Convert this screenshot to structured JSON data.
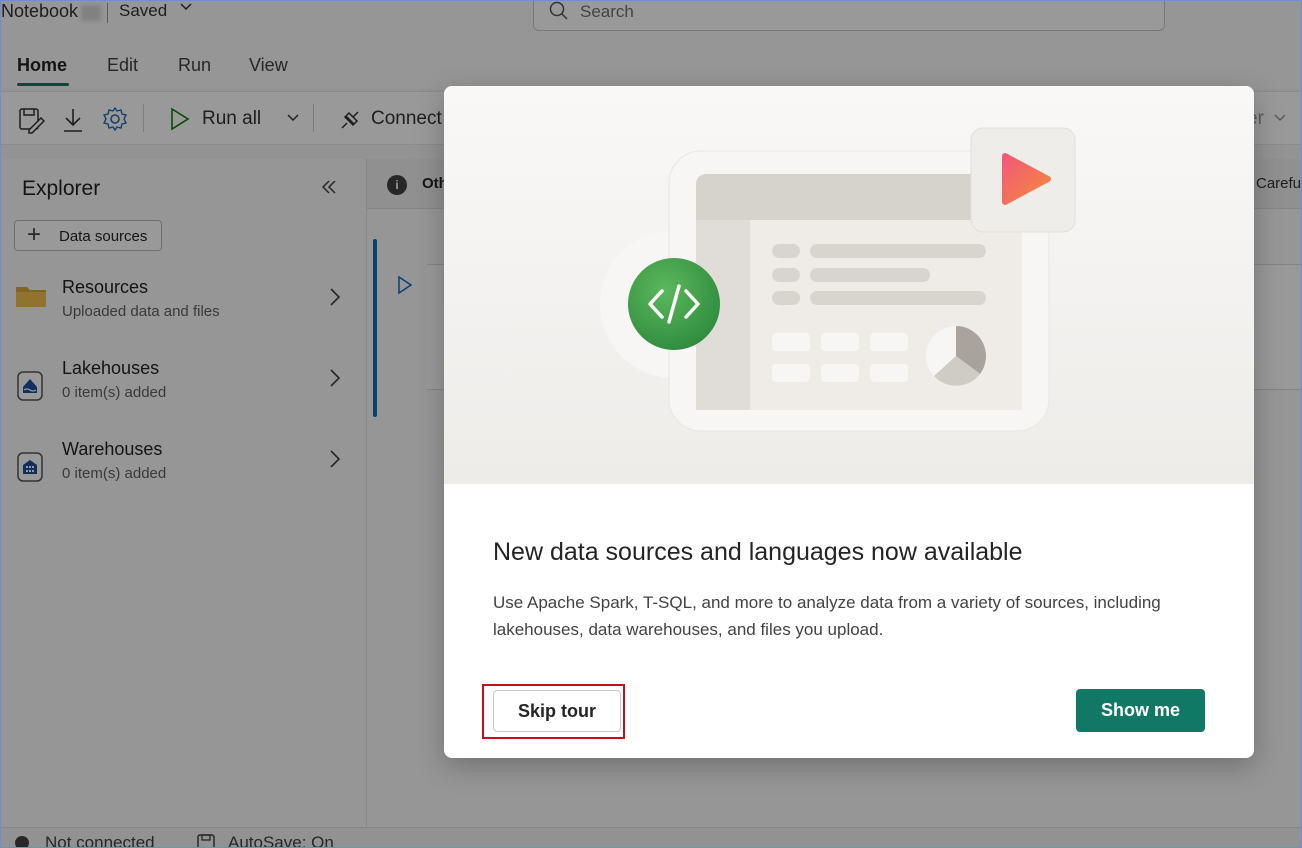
{
  "titlebar": {
    "notebook_name": "Notebook",
    "status": "Saved",
    "search_placeholder": "Search"
  },
  "menu_tabs": [
    "Home",
    "Edit",
    "Run",
    "View"
  ],
  "toolbar": {
    "run_all": "Run all",
    "connect": "Connect",
    "partial_right": "er"
  },
  "explorer": {
    "title": "Explorer",
    "add_button": "Data sources",
    "items": [
      {
        "name": "Resources",
        "sub": "Uploaded data and files"
      },
      {
        "name": "Lakehouses",
        "sub": "0 item(s) added"
      },
      {
        "name": "Warehouses",
        "sub": "0 item(s) added"
      }
    ]
  },
  "editor": {
    "info_text": "Oth",
    "info_right": "Carefu"
  },
  "statusbar": {
    "connection": "Not connected",
    "autosave": "AutoSave: On"
  },
  "dialog": {
    "title": "New data sources and languages now available",
    "body": "Use Apache Spark, T-SQL, and more to analyze data from a variety of sources, including lakehouses, data warehouses, and files you upload.",
    "skip_label": "Skip tour",
    "show_label": "Show me"
  },
  "colors": {
    "accent": "#117865",
    "highlight_outline": "#c0101c",
    "code_badge": "#43a047"
  }
}
